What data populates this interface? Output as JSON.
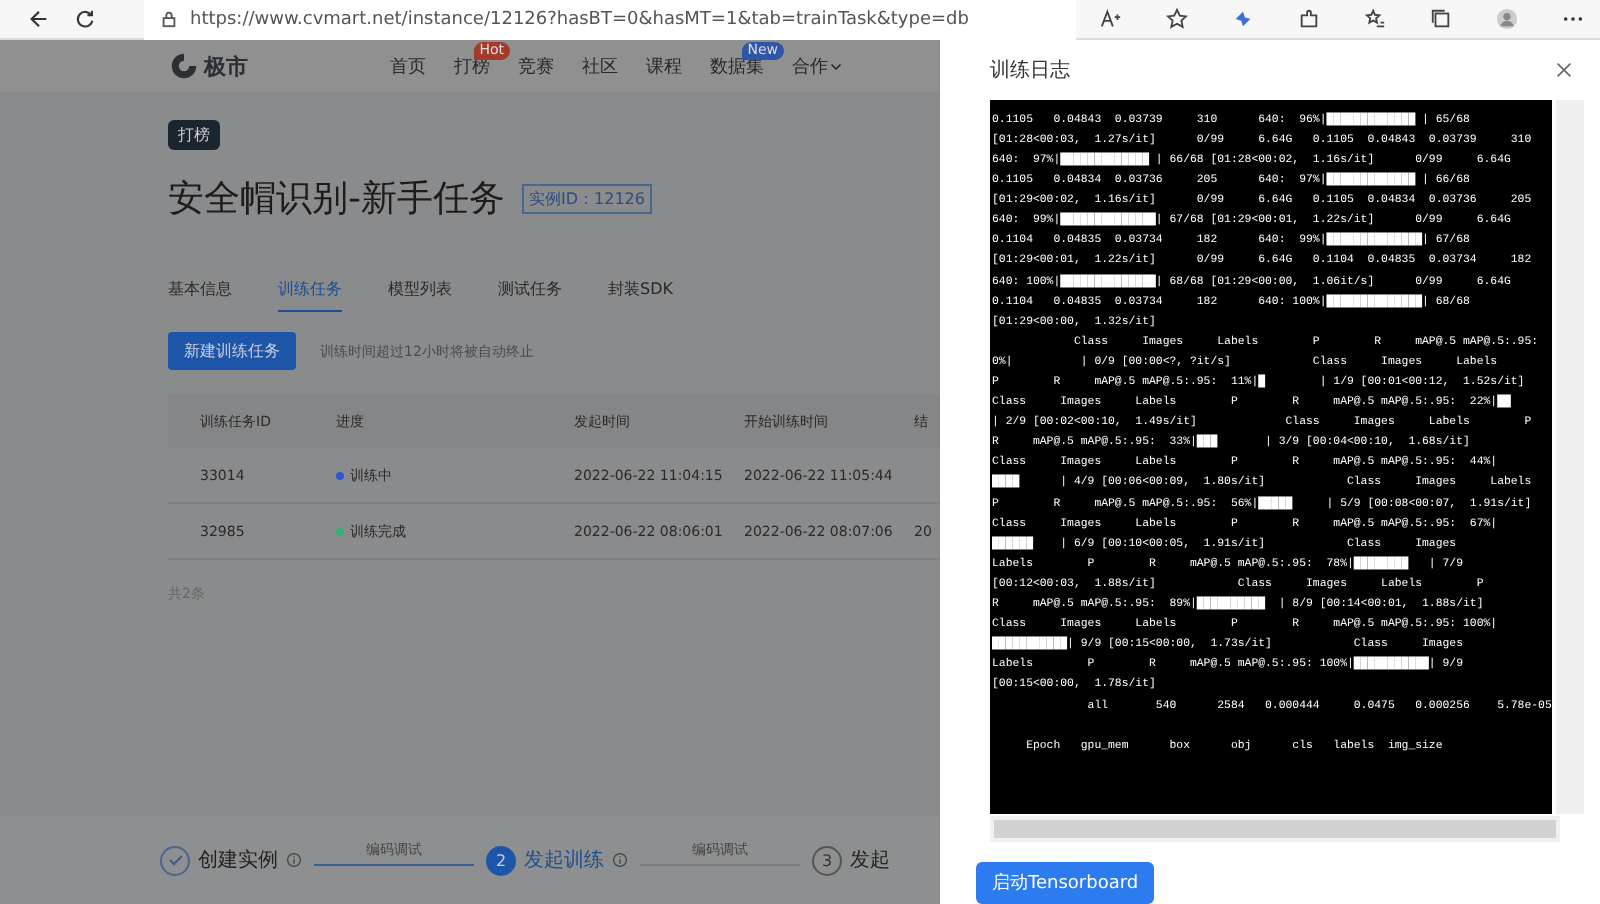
{
  "browser": {
    "url": "https://www.cvmart.net/instance/12126?hasBT=0&hasMT=1&tab=trainTask&type=db"
  },
  "site_nav": {
    "logo": "极市",
    "items": [
      {
        "label": "首页"
      },
      {
        "label": "打榜",
        "badge": "Hot"
      },
      {
        "label": "竞赛"
      },
      {
        "label": "社区"
      },
      {
        "label": "课程"
      },
      {
        "label": "数据集",
        "badge": "New"
      },
      {
        "label": "合作",
        "dropdown": true
      }
    ]
  },
  "instance": {
    "tag": "打榜",
    "title": "安全帽识别-新手任务",
    "id_badge": "实例ID：12126"
  },
  "tabs": [
    {
      "label": "基本信息",
      "selected": false
    },
    {
      "label": "训练任务",
      "selected": true
    },
    {
      "label": "模型列表",
      "selected": false
    },
    {
      "label": "测试任务",
      "selected": false
    },
    {
      "label": "封装SDK",
      "selected": false
    }
  ],
  "new_task_button": "新建训练任务",
  "hint": "训练时间超过12小时将被自动终止",
  "table": {
    "columns": [
      "训练任务ID",
      "进度",
      "发起时间",
      "开始训练时间",
      "结"
    ],
    "rows": [
      {
        "id": "33014",
        "progress": "训练中",
        "color": "#2f55d4",
        "created": "2022-06-22 11:04:15",
        "started": "2022-06-22 11:05:44"
      },
      {
        "id": "32985",
        "progress": "训练完成",
        "color": "#2fb36b",
        "created": "2022-06-22 08:06:01",
        "started": "2022-06-22 08:07:06",
        "column_5": "20"
      }
    ]
  },
  "total": "共2条",
  "steps": [
    {
      "kind": "done",
      "label": "创建实例",
      "connector": "编码调试"
    },
    {
      "kind": "active",
      "number": "2",
      "label": "发起训练",
      "connector": "编码调试"
    },
    {
      "kind": "pending",
      "number": "3",
      "label": "发起"
    }
  ],
  "drawer": {
    "title": "训练日志",
    "log": [
      "0.1105   0.04843  0.03739     310      640:  96%|█████████████ | 65/68",
      "[01:28<00:03,  1.27s/it]      0/99     6.64G   0.1105  0.04843  0.03739     310",
      "640:  97%|█████████████ | 66/68 [01:28<00:02,  1.16s/it]      0/99     6.64G",
      "0.1105   0.04834  0.03736     205      640:  97%|█████████████ | 66/68",
      "[01:29<00:02,  1.16s/it]      0/99     6.64G   0.1105  0.04834  0.03736     205",
      "640:  99%|██████████████| 67/68 [01:29<00:01,  1.22s/it]      0/99     6.64G",
      "0.1104   0.04835  0.03734     182      640:  99%|██████████████| 67/68",
      "[01:29<00:01,  1.22s/it]      0/99     6.64G   0.1104  0.04835  0.03734     182",
      "640: 100%|██████████████| 68/68 [01:29<00:00,  1.06it/s]      0/99     6.64G",
      "0.1104   0.04835  0.03734     182      640: 100%|██████████████| 68/68",
      "[01:29<00:00,  1.32s/it]",
      "            Class     Images     Labels        P        R     mAP@.5 mAP@.5:.95:",
      "0%|          | 0/9 [00:00<?, ?it/s]            Class     Images     Labels",
      "P        R     mAP@.5 mAP@.5:.95:  11%|█        | 1/9 [00:01<00:12,  1.52s/it]",
      "Class     Images     Labels        P        R     mAP@.5 mAP@.5:.95:  22%|██",
      "| 2/9 [00:02<00:10,  1.49s/it]             Class     Images     Labels        P",
      "R     mAP@.5 mAP@.5:.95:  33%|███       | 3/9 [00:04<00:10,  1.68s/it]",
      "Class     Images     Labels        P        R     mAP@.5 mAP@.5:.95:  44%|",
      "████      | 4/9 [00:06<00:09,  1.80s/it]            Class     Images     Labels",
      "P        R     mAP@.5 mAP@.5:.95:  56%|█████     | 5/9 [00:08<00:07,  1.91s/it]",
      "Class     Images     Labels        P        R     mAP@.5 mAP@.5:.95:  67%|",
      "██████    | 6/9 [00:10<00:05,  1.91s/it]            Class     Images",
      "Labels        P        R     mAP@.5 mAP@.5:.95:  78%|████████   | 7/9",
      "[00:12<00:03,  1.88s/it]            Class     Images     Labels        P",
      "R     mAP@.5 mAP@.5:.95:  89%|██████████  | 8/9 [00:14<00:01,  1.88s/it]",
      "Class     Images     Labels        P        R     mAP@.5 mAP@.5:.95: 100%|",
      "███████████| 9/9 [00:15<00:00,  1.73s/it]            Class     Images",
      "Labels        P        R     mAP@.5 mAP@.5:.95: 100%|███████████| 9/9",
      "[00:15<00:00,  1.78s/it]",
      "              all       540      2584   0.000444     0.0475   0.000256    5.78e-05",
      "     Epoch   gpu_mem      box      obj      cls   labels  img_size"
    ],
    "button": "启动Tensorboard"
  }
}
